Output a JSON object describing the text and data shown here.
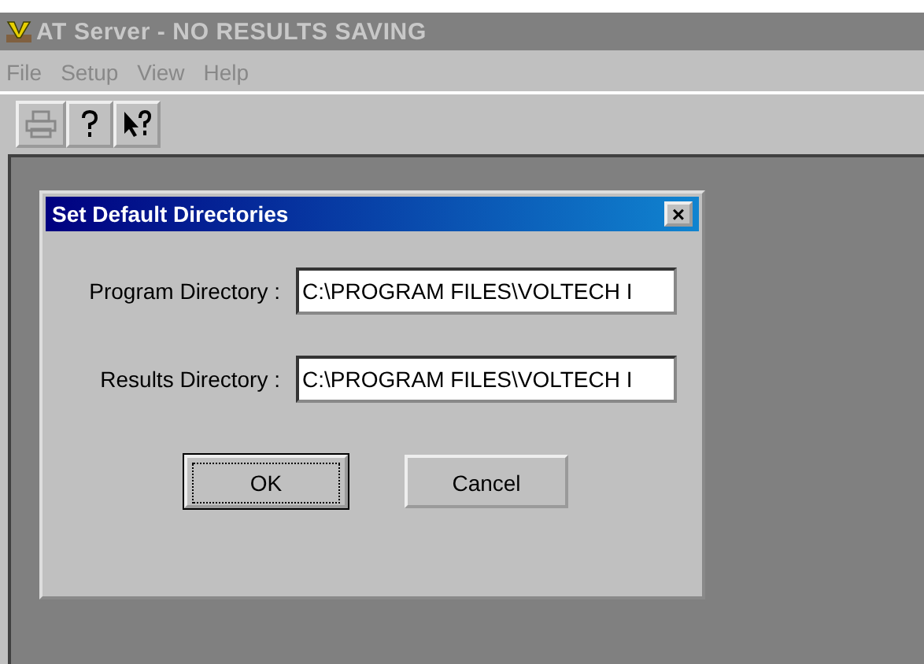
{
  "window": {
    "title": "AT Server - NO RESULTS SAVING",
    "active": false
  },
  "menu": [
    {
      "label": "File",
      "disabled": true
    },
    {
      "label": "Setup",
      "disabled": true
    },
    {
      "label": "View",
      "disabled": true
    },
    {
      "label": "Help",
      "disabled": true
    }
  ],
  "toolbar": [
    {
      "kind": "print"
    },
    {
      "kind": "help"
    },
    {
      "kind": "context-help"
    }
  ],
  "dialog": {
    "title": "Set Default Directories",
    "active": true,
    "close": "×",
    "fields": [
      {
        "label": "Program Directory :",
        "value": "C:\\PROGRAM FILES\\VOLTECH I"
      },
      {
        "label": "Results Directory :",
        "value": "C:\\PROGRAM FILES\\VOLTECH I"
      }
    ],
    "buttons": [
      {
        "label": "OK",
        "default": true
      },
      {
        "label": "Cancel",
        "default": false
      }
    ]
  }
}
